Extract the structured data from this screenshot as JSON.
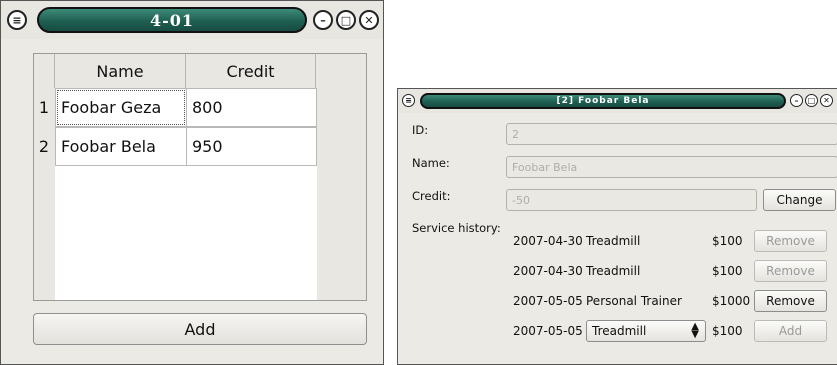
{
  "window1": {
    "title": "4-01",
    "controls": {
      "menu": "≡",
      "minimize": "–",
      "maximize": "□",
      "close": "✕"
    },
    "table": {
      "columns": [
        "Name",
        "Credit"
      ],
      "rows": [
        {
          "num": "1",
          "name": "Foobar Geza",
          "credit": "800"
        },
        {
          "num": "2",
          "name": "Foobar Bela",
          "credit": "950"
        }
      ]
    },
    "add_label": "Add"
  },
  "window2": {
    "title": "[2] Foobar Bela",
    "controls": {
      "menu": "≡",
      "minimize": "–",
      "maximize": "□",
      "close": "✕"
    },
    "fields": {
      "id_label": "ID:",
      "id_value": "2",
      "name_label": "Name:",
      "name_value": "Foobar Bela",
      "credit_label": "Credit:",
      "credit_value": "-50",
      "change_label": "Change"
    },
    "history_label": "Service history:",
    "history": [
      {
        "date": "2007-04-30",
        "service": "Treadmill",
        "price": "$100",
        "action": "Remove",
        "enabled": false
      },
      {
        "date": "2007-04-30",
        "service": "Treadmill",
        "price": "$100",
        "action": "Remove",
        "enabled": false
      },
      {
        "date": "2007-05-05",
        "service": "Personal Trainer",
        "price": "$1000",
        "action": "Remove",
        "enabled": true
      }
    ],
    "new_entry": {
      "date": "2007-05-05",
      "service": "Treadmill",
      "price": "$100",
      "action": "Add"
    }
  }
}
